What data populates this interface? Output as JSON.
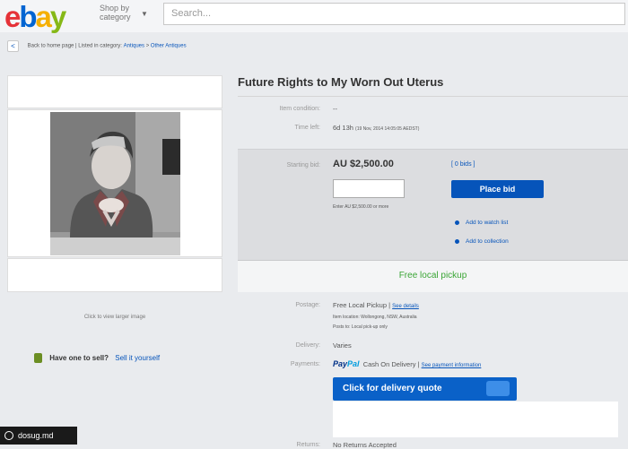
{
  "header": {
    "logo": {
      "e": "e",
      "b": "b",
      "a": "a",
      "y": "y"
    },
    "shop_by_line1": "Shop by",
    "shop_by_line2": "category",
    "search_placeholder": "Search..."
  },
  "breadcrumb": {
    "back_label": "Back to home page",
    "separator": "|",
    "listed_in": "Listed in category:",
    "cat1": "Antiques",
    "arrow": ">",
    "cat2": "Other Antiques"
  },
  "listing": {
    "title": "Future Rights to My Worn Out Uterus",
    "condition_label": "Item condition:",
    "condition_value": "--",
    "time_left_label": "Time left:",
    "time_left_value": "6d 13h",
    "time_left_detail": "(19 Nov, 2014   14:05:05 AEDST)"
  },
  "bid": {
    "starting_label": "Starting bid:",
    "price": "AU $2,500.00",
    "bids_link": "[ 0 bids ]",
    "enter_hint": "Enter AU $2,500.00 or more",
    "place_bid": "Place bid",
    "watch_list": "Add to watch list",
    "collection": "Add to collection",
    "pickup": "Free local pickup"
  },
  "details": {
    "postage_label": "Postage:",
    "postage_value": "Free Local Pickup",
    "postage_sep": "|",
    "see_details": "See details",
    "item_location": "Item location:   Wollongong, NSW, Australia",
    "posts_to": "Posts to:   Local pick-up only",
    "delivery_label": "Delivery:",
    "delivery_value": "Varies",
    "payments_label": "Payments:",
    "paypal_pay": "Pay",
    "paypal_pal": "Pal",
    "payments_value": "Cash On Delivery",
    "payments_sep": "|",
    "see_payment": "See payment information",
    "quote_button": "Click for delivery quote",
    "returns_label": "Returns:",
    "returns_value": "No Returns Accepted"
  },
  "image_panel": {
    "enlarge": "Click to view larger image"
  },
  "sell": {
    "question": "Have one to sell?",
    "link": "Sell it yourself"
  },
  "watermark": "dosug.md"
}
